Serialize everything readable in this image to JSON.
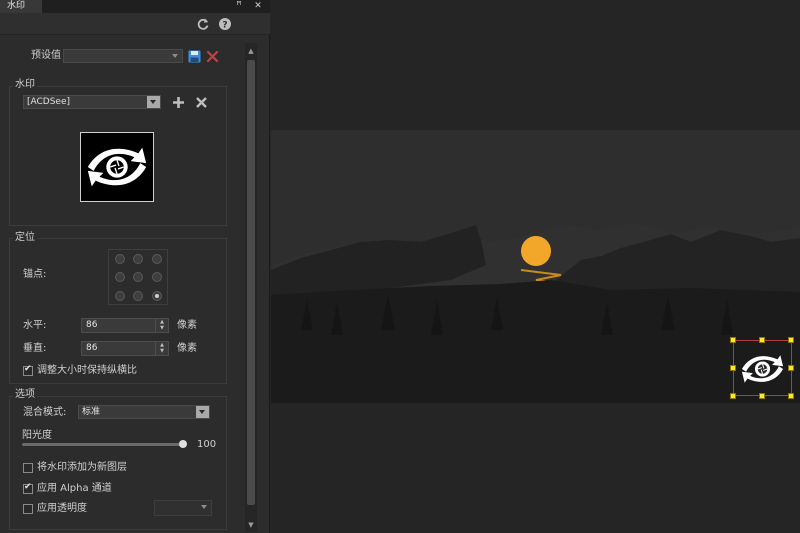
{
  "panel": {
    "tab_title": "水印",
    "tab_controls": {
      "pin": "ꟸ",
      "close": "✕"
    },
    "toolbar_icons": [
      "refresh-icon",
      "help-icon"
    ]
  },
  "preset": {
    "label": "预设值",
    "value": "",
    "icons": [
      "save-icon",
      "delete-icon"
    ]
  },
  "watermark_group": {
    "title": "水印",
    "selected": "[ACDSee]",
    "icons": [
      "add-icon",
      "remove-icon"
    ]
  },
  "position_group": {
    "title": "定位",
    "anchor_label": "锚点:",
    "anchor_selected": "bottom-right",
    "horizontal": {
      "label": "水平:",
      "value": "86",
      "unit": "像素"
    },
    "vertical": {
      "label": "垂直:",
      "value": "86",
      "unit": "像素"
    },
    "keep_ratio": {
      "label": "调整大小时保持纵横比",
      "checked": true
    }
  },
  "options_group": {
    "title": "选项",
    "blend_mode": {
      "label": "混合模式:",
      "value": "标准"
    },
    "opacity": {
      "label": "阳光度",
      "value": "100",
      "fraction": 1.0
    },
    "add_as_layer": {
      "label": "将水印添加为新图层",
      "checked": false
    },
    "apply_alpha": {
      "label": "应用 Alpha 通道",
      "checked": true
    },
    "apply_transparency": {
      "label": "应用透明度",
      "checked": false,
      "value": ""
    }
  },
  "colors": {
    "panel_bg": "#2c2c2c",
    "canvas_bg": "#252525",
    "sun": "#f2a72a",
    "handle": "#ffe62b",
    "delete_red": "#d23b3b",
    "save_blue": "#3f8fd8"
  }
}
